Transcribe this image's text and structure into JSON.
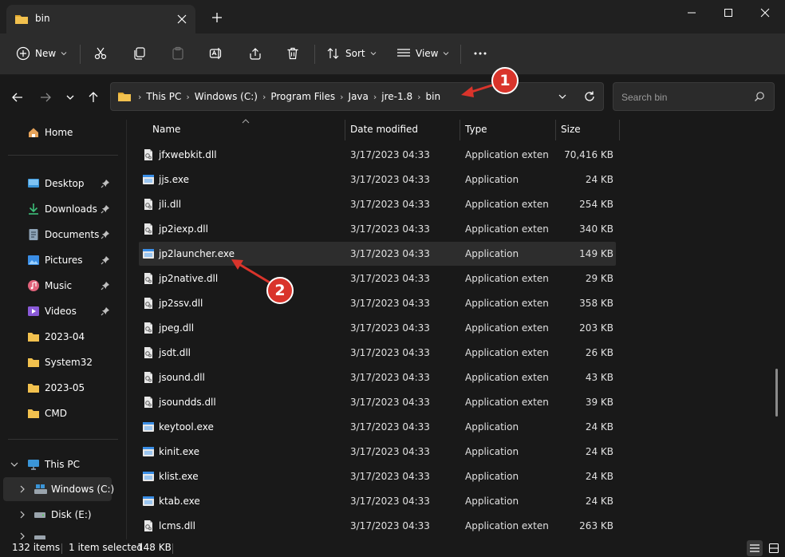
{
  "window": {
    "tab_title": "bin"
  },
  "toolbar": {
    "new_label": "New",
    "sort_label": "Sort",
    "view_label": "View",
    "more_label": "•••"
  },
  "address": {
    "crumbs": [
      "This PC",
      "Windows (C:)",
      "Program Files",
      "Java",
      "jre-1.8",
      "bin"
    ]
  },
  "search": {
    "placeholder": "Search bin"
  },
  "sidebar": {
    "home": "Home",
    "quick": [
      "Desktop",
      "Downloads",
      "Documents",
      "Pictures",
      "Music",
      "Videos"
    ],
    "folders": [
      "2023-04",
      "System32",
      "2023-05",
      "CMD"
    ],
    "this_pc": "This PC",
    "drives": [
      "Windows (C:)",
      "Disk (E:)"
    ]
  },
  "columns": {
    "name": "Name",
    "date": "Date modified",
    "type": "Type",
    "size": "Size"
  },
  "files": [
    {
      "name": "jfxwebkit.dll",
      "date": "3/17/2023 04:33",
      "type": "Application exten...",
      "size": "70,416 KB",
      "icon": "dll-icon"
    },
    {
      "name": "jjs.exe",
      "date": "3/17/2023 04:33",
      "type": "Application",
      "size": "24 KB",
      "icon": "exe-icon"
    },
    {
      "name": "jli.dll",
      "date": "3/17/2023 04:33",
      "type": "Application exten...",
      "size": "254 KB",
      "icon": "dll-icon"
    },
    {
      "name": "jp2iexp.dll",
      "date": "3/17/2023 04:33",
      "type": "Application exten...",
      "size": "340 KB",
      "icon": "dll-icon"
    },
    {
      "name": "jp2launcher.exe",
      "date": "3/17/2023 04:33",
      "type": "Application",
      "size": "149 KB",
      "icon": "exe-icon",
      "selected": true
    },
    {
      "name": "jp2native.dll",
      "date": "3/17/2023 04:33",
      "type": "Application exten...",
      "size": "29 KB",
      "icon": "dll-icon"
    },
    {
      "name": "jp2ssv.dll",
      "date": "3/17/2023 04:33",
      "type": "Application exten...",
      "size": "358 KB",
      "icon": "dll-icon"
    },
    {
      "name": "jpeg.dll",
      "date": "3/17/2023 04:33",
      "type": "Application exten...",
      "size": "203 KB",
      "icon": "dll-icon"
    },
    {
      "name": "jsdt.dll",
      "date": "3/17/2023 04:33",
      "type": "Application exten...",
      "size": "26 KB",
      "icon": "dll-icon"
    },
    {
      "name": "jsound.dll",
      "date": "3/17/2023 04:33",
      "type": "Application exten...",
      "size": "43 KB",
      "icon": "dll-icon"
    },
    {
      "name": "jsoundds.dll",
      "date": "3/17/2023 04:33",
      "type": "Application exten...",
      "size": "39 KB",
      "icon": "dll-icon"
    },
    {
      "name": "keytool.exe",
      "date": "3/17/2023 04:33",
      "type": "Application",
      "size": "24 KB",
      "icon": "exe-icon"
    },
    {
      "name": "kinit.exe",
      "date": "3/17/2023 04:33",
      "type": "Application",
      "size": "24 KB",
      "icon": "exe-icon"
    },
    {
      "name": "klist.exe",
      "date": "3/17/2023 04:33",
      "type": "Application",
      "size": "24 KB",
      "icon": "exe-icon"
    },
    {
      "name": "ktab.exe",
      "date": "3/17/2023 04:33",
      "type": "Application",
      "size": "24 KB",
      "icon": "exe-icon"
    },
    {
      "name": "lcms.dll",
      "date": "3/17/2023 04:33",
      "type": "Application exten...",
      "size": "263 KB",
      "icon": "dll-icon"
    }
  ],
  "status": {
    "items_count": "132 items",
    "selected": "1 item selected",
    "selected_size": "148 KB"
  },
  "annotations": {
    "badge_1": "1",
    "badge_2": "2"
  },
  "colors": {
    "annotation_red": "#d9342b",
    "folder_yellow": "#f2c14e",
    "accent_blue": "#4cc2ff"
  }
}
